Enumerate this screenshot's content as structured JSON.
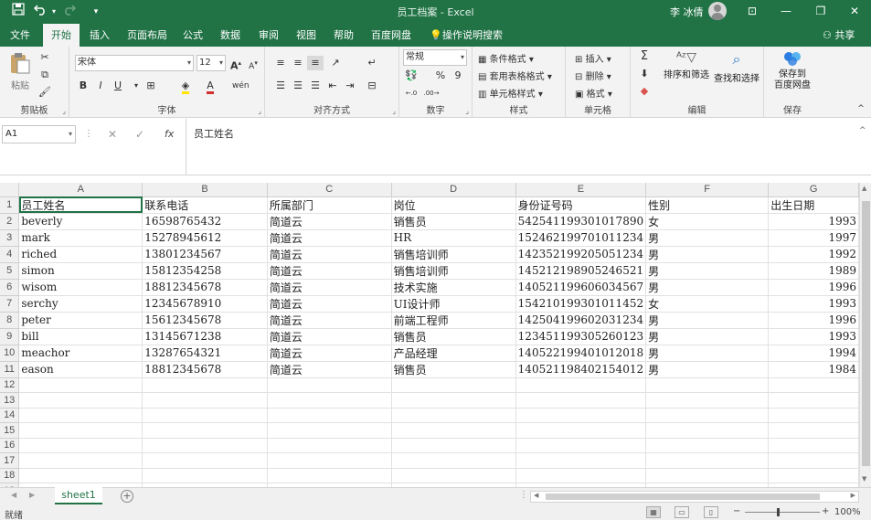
{
  "window": {
    "title": "员工档案 - Excel",
    "user_name": "李 冰倩",
    "minimize_glyph": "—",
    "restore_glyph": "❐",
    "close_glyph": "✕",
    "ribbon_display_glyph": "⊡"
  },
  "quick_access": {
    "save_icon": "save-icon",
    "undo_icon": "undo-icon",
    "redo_icon": "redo-icon",
    "customize_glyph": "▾"
  },
  "tabs": [
    "文件",
    "开始",
    "插入",
    "页面布局",
    "公式",
    "数据",
    "审阅",
    "视图",
    "帮助",
    "百度网盘"
  ],
  "active_tab": "开始",
  "tell_me": "操作说明搜索",
  "share": "共享",
  "ribbon": {
    "clipboard": {
      "label": "剪贴板",
      "paste": "粘贴"
    },
    "font": {
      "label": "字体",
      "font_name": "宋体",
      "font_size": "12",
      "grow": "A",
      "shrink": "A",
      "bold": "B",
      "italic": "I",
      "underline": "U",
      "wen": "wén"
    },
    "alignment": {
      "label": "对齐方式"
    },
    "number": {
      "label": "数字",
      "format": "常规",
      "percent": "%",
      "comma": "9"
    },
    "styles": {
      "label": "样式",
      "conditional": "条件格式",
      "table_format": "套用表格格式",
      "cell_styles": "单元格样式"
    },
    "cells": {
      "label": "单元格",
      "insert": "插入",
      "delete": "删除",
      "format": "格式"
    },
    "editing": {
      "label": "编辑",
      "sum": "Σ",
      "sort_filter": "排序和筛选",
      "find_select": "查找和选择"
    },
    "save": {
      "label": "保存",
      "save_to_baidu_1": "保存到",
      "save_to_baidu_2": "百度网盘"
    }
  },
  "formula_bar": {
    "name_box": "A1",
    "cancel": "✕",
    "enter": "✓",
    "fx": "fx",
    "content": "员工姓名"
  },
  "sheet": {
    "column_headers": [
      "A",
      "B",
      "C",
      "D",
      "E",
      "F",
      "G"
    ],
    "header_row": [
      "员工姓名",
      "联系电话",
      "所属部门",
      "岗位",
      "身份证号码",
      "性别",
      "出生日期"
    ],
    "rows": [
      [
        "beverly",
        "16598765432",
        "简道云",
        "销售员",
        "542541199301017890",
        "女",
        "1993"
      ],
      [
        "mark",
        "15278945612",
        "简道云",
        "HR",
        "152462199701011234",
        "男",
        "1997"
      ],
      [
        "riched",
        "13801234567",
        "简道云",
        "销售培训师",
        "142352199205051234",
        "男",
        "1992"
      ],
      [
        "simon",
        "15812354258",
        "简道云",
        "销售培训师",
        "145212198905246521",
        "男",
        "1989"
      ],
      [
        "wisom",
        "18812345678",
        "简道云",
        "技术实施",
        "140521199606034567",
        "男",
        "1996"
      ],
      [
        "serchy",
        "12345678910",
        "简道云",
        "UI设计师",
        "154210199301011452",
        "女",
        "1993"
      ],
      [
        "peter",
        "15612345678",
        "简道云",
        "前端工程师",
        "142504199602031234",
        "男",
        "1996"
      ],
      [
        "bill",
        "13145671238",
        "简道云",
        "销售员",
        "123451199305260123",
        "男",
        "1993"
      ],
      [
        "meachor",
        "13287654321",
        "简道云",
        "产品经理",
        "140522199401012018",
        "男",
        "1994"
      ],
      [
        "eason",
        "18812345678",
        "简道云",
        "销售员",
        "140521198402154012",
        "男",
        "1984"
      ]
    ],
    "row_numbers": [
      "1",
      "2",
      "3",
      "4",
      "5",
      "6",
      "7",
      "8",
      "9",
      "10",
      "11",
      "12",
      "13",
      "14",
      "15",
      "16",
      "17",
      "18",
      "19"
    ]
  },
  "sheet_tabs": {
    "active": "sheet1",
    "add": "+"
  },
  "status": {
    "ready": "就绪",
    "zoom": "100%",
    "zoom_minus": "−",
    "zoom_plus": "+"
  },
  "colors": {
    "brand": "#217346",
    "ribbon_bg": "#f3f3f3",
    "grid_line": "#e1e1e1"
  }
}
